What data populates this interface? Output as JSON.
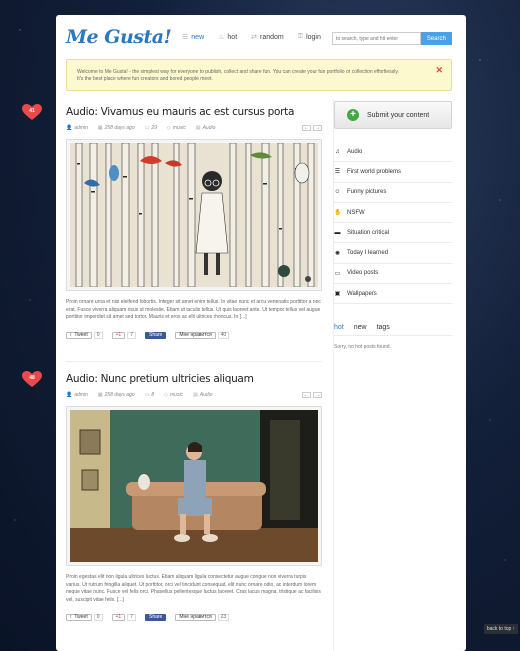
{
  "logo": "Me Gusta!",
  "nav": [
    {
      "label": "new",
      "icon": "list-icon"
    },
    {
      "label": "hot",
      "icon": "flame-icon"
    },
    {
      "label": "random",
      "icon": "shuffle-icon"
    },
    {
      "label": "login",
      "icon": "key-icon"
    }
  ],
  "search": {
    "placeholder": "to search, type and hit enter",
    "button": "Search"
  },
  "notice": {
    "line1": "Welcome to Me Gusta! - the simplest way for everyone to publish, collect and share fun. You can create your fun portfolio or collection effortlessly.",
    "line2": "It's the best place where fun creators and bored people meet.",
    "close": "✕"
  },
  "posts": [
    {
      "likes": "41",
      "title": "Audio: Vivamus eu mauris ac est cursus porta",
      "author": "admin",
      "date": "258 days ago",
      "comments": "29",
      "tag": "music",
      "category": "Audio",
      "excerpt": "Proin ornare urna et nisi eleifend lobortis. Integer sit amet enim tellus. In vitae nunc et arcu venenatis porttitor a nec erat. Fusce viverra aliquam risus ut molestie. Etiam ut iaculis tellus. Ut quis laoreet ante. Ut tempor tellus vel augue porttitor imperdiet sit amet sed tortor. Mauris et eros ac elit ultrices rhoncus. In [...]",
      "tweet": "Tweet",
      "tweet_count": "0",
      "plus": "+1",
      "plus_count": "7",
      "share": "Share",
      "fb_like": "Мне нравится",
      "fb_count": "40"
    },
    {
      "likes": "48",
      "title": "Audio: Nunc pretium ultricies aliquam",
      "author": "admin",
      "date": "258 days ago",
      "comments": "8",
      "tag": "music",
      "category": "Audio",
      "excerpt": "Proin egestas elit non ligula ultrices luctus. Etiam aliquam ligula consectetur augue congue non viverra turpis varius. Ut rutrum fringilla aliquet. Ut porttitor, orci vel tincidunt consequat, elit nunc ornare odio, ac interdum lorem neque vitae nunc. Fusce vel felis orci. Phasellus pellentesque luctus laoreet. Cras lacus magna, tristique ac facilisis vel, suscipit vitae felis. [...]",
      "tweet": "Tweet",
      "tweet_count": "0",
      "plus": "+1",
      "plus_count": "7",
      "share": "Share",
      "fb_like": "Мне нравится",
      "fb_count": "23"
    }
  ],
  "sidebar": {
    "submit": "Submit your content",
    "categories": [
      {
        "label": "Audio",
        "icon": "music-icon"
      },
      {
        "label": "First world problems",
        "icon": "list-icon"
      },
      {
        "label": "Funny pictures",
        "icon": "smiley-icon"
      },
      {
        "label": "NSFW",
        "icon": "hand-icon"
      },
      {
        "label": "Situation critical",
        "icon": "battery-icon"
      },
      {
        "label": "Today I learned",
        "icon": "lightbulb-icon"
      },
      {
        "label": "Video posts",
        "icon": "video-icon"
      },
      {
        "label": "Wallpapers",
        "icon": "image-icon"
      }
    ],
    "tabs": [
      "hot",
      "new",
      "tags"
    ],
    "no_hot": "Sorry, no hot posts found."
  },
  "back_to_top": "back to top ↑",
  "colors": {
    "accent": "#2a78c2",
    "heart": "#e84a4a",
    "notice_bg": "#fdf9cf",
    "search_btn": "#4aa1e8"
  }
}
